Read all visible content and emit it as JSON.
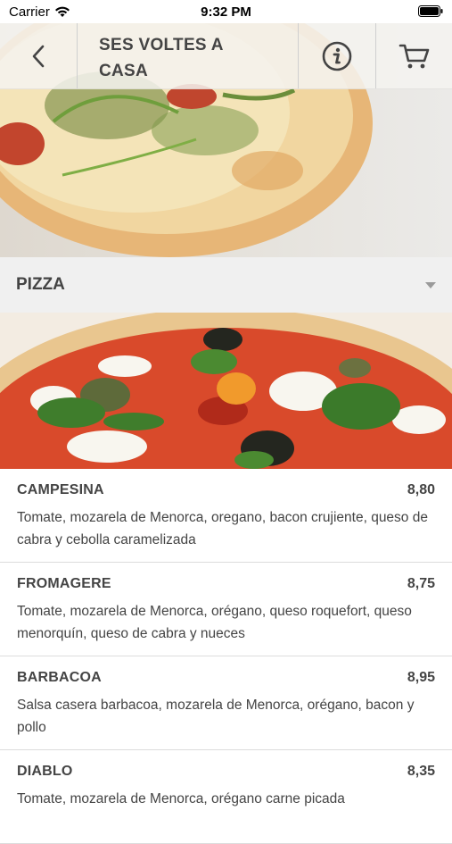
{
  "status_bar": {
    "carrier": "Carrier",
    "time": "9:32 PM"
  },
  "header": {
    "title_line1": "SES VOLTES A",
    "title_line2": "CASA"
  },
  "category": {
    "label": "PIZZA"
  },
  "menu_items": [
    {
      "name": "CAMPESINA",
      "price": "8,80",
      "description": "Tomate, mozarela de Menorca, oregano, bacon crujiente, queso de cabra y cebolla caramelizada"
    },
    {
      "name": "FROMAGERE",
      "price": "8,75",
      "description": "Tomate, mozarela de Menorca, orégano, queso roquefort, queso menorquín, queso de cabra y nueces"
    },
    {
      "name": "BARBACOA",
      "price": "8,95",
      "description": "Salsa casera barbacoa, mozarela de Menorca, orégano, bacon y pollo"
    },
    {
      "name": "DIABLO",
      "price": "8,35",
      "description": "Tomate, mozarela de Menorca, orégano carne picada"
    }
  ],
  "colors": {
    "header_bg": "#f4f3f0",
    "category_bg": "#f0f0f0",
    "text": "#444444",
    "divider": "#dcdcdc"
  }
}
